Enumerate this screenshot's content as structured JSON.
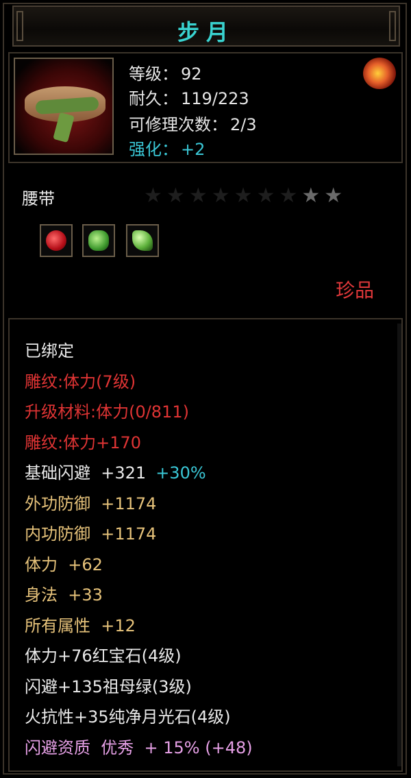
{
  "title": "步月",
  "stats": [
    {
      "label": "等级",
      "sep": "：",
      "value": "92",
      "color": "white"
    },
    {
      "label": "耐久",
      "sep": "：",
      "value": "119/223",
      "color": "white"
    },
    {
      "label": "可修理次数",
      "sep": "：",
      "value": "2/3",
      "color": "white"
    },
    {
      "label": "强化",
      "sep": "：",
      "value": "+2",
      "color": "cyan"
    }
  ],
  "item_type": "腰带",
  "stars": {
    "total": 9,
    "lit": 2
  },
  "gems": [
    "ruby",
    "emerald",
    "emerald-shard"
  ],
  "quality": "珍品",
  "attributes": [
    {
      "text": "已绑定",
      "color": "#eaeaea"
    },
    {
      "text": "雕纹:体力(7级)",
      "color": "#e03434"
    },
    {
      "text": "升级材料:体力(0/811)",
      "color": "#e03434"
    },
    {
      "text": "雕纹:体力+170",
      "color": "#e03434"
    },
    {
      "text": "基础闪避  +321",
      "extra": "+30%",
      "color": "#eaeaea"
    },
    {
      "text": "外功防御  +1174",
      "color": "#e6c27a"
    },
    {
      "text": "内功防御  +1174",
      "color": "#e6c27a"
    },
    {
      "text": "体力  +62",
      "color": "#e6c27a"
    },
    {
      "text": "身法  +33",
      "color": "#e6c27a"
    },
    {
      "text": "所有属性  +12",
      "color": "#e6c27a"
    },
    {
      "text": "体力+76红宝石(4级)",
      "color": "#eaeaea"
    },
    {
      "text": "闪避+135祖母绿(3级)",
      "color": "#eaeaea"
    },
    {
      "text": "火抗性+35纯净月光石(4级)",
      "color": "#eaeaea"
    },
    {
      "text": "闪避资质  优秀  + 15% (+48)",
      "color": "#e6a0e6"
    }
  ]
}
